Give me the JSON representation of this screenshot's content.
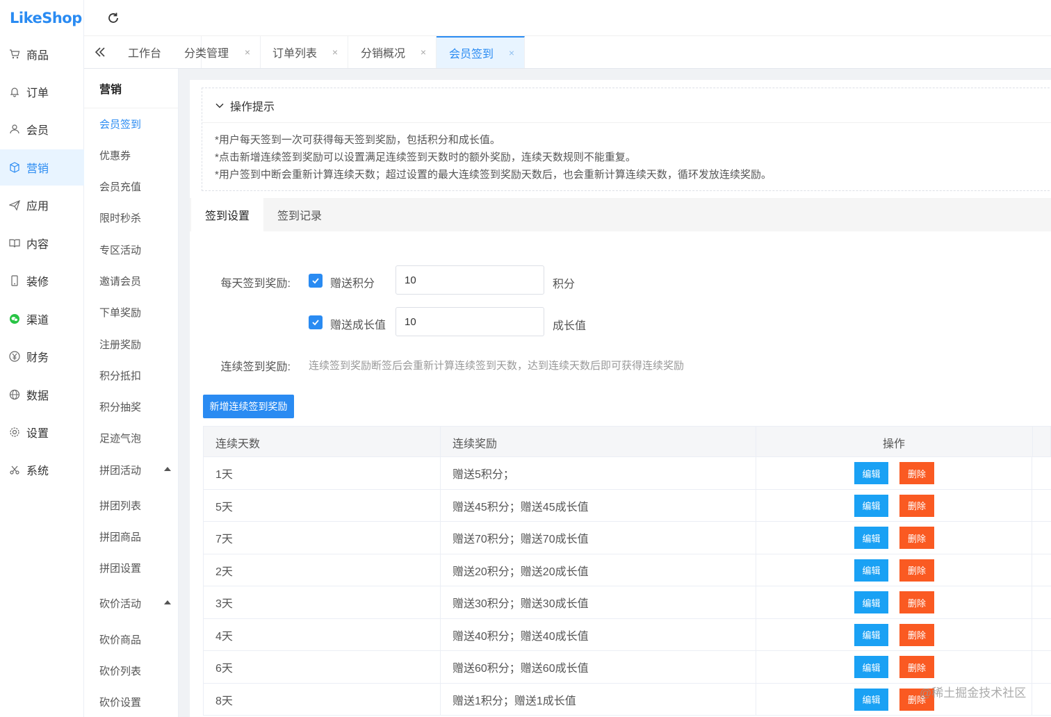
{
  "app": {
    "logo": "LikeShop",
    "refresh_icon": "refresh-icon",
    "accent": "#2a8bf2"
  },
  "sidebar": {
    "items": [
      {
        "label": "商品",
        "icon": "cart-icon"
      },
      {
        "label": "订单",
        "icon": "bell-icon"
      },
      {
        "label": "会员",
        "icon": "user-icon"
      },
      {
        "label": "营销",
        "icon": "box-icon"
      },
      {
        "label": "应用",
        "icon": "send-icon"
      },
      {
        "label": "内容",
        "icon": "book-icon"
      },
      {
        "label": "装修",
        "icon": "phone-icon"
      },
      {
        "label": "渠道",
        "icon": "wechat-icon"
      },
      {
        "label": "财务",
        "icon": "yen-icon"
      },
      {
        "label": "数据",
        "icon": "globe-icon"
      },
      {
        "label": "设置",
        "icon": "gear-icon"
      },
      {
        "label": "系统",
        "icon": "scissors-icon"
      }
    ],
    "active": "营销"
  },
  "tabs": [
    {
      "label": "工作台"
    },
    {
      "label": "分类管理",
      "close": "×"
    },
    {
      "label": "订单列表",
      "close": "×"
    },
    {
      "label": "分销概况",
      "close": "×"
    },
    {
      "label": "会员签到",
      "close": "×"
    }
  ],
  "submenu": {
    "title": "营销",
    "items": [
      "会员签到",
      "优惠券",
      "会员充值",
      "限时秒杀",
      "专区活动",
      "邀请会员",
      "下单奖励",
      "注册奖励",
      "积分抵扣",
      "积分抽奖",
      "足迹气泡",
      "拼团活动",
      "拼团列表",
      "拼团商品",
      "拼团设置",
      "砍价活动",
      "砍价商品",
      "砍价列表",
      "砍价设置"
    ]
  },
  "tips": {
    "title": "操作提示",
    "lines": [
      "*用户每天签到一次可获得每天签到奖励，包括积分和成长值。",
      "*点击新增连续签到奖励可以设置满足连续签到天数时的额外奖励，连续天数规则不能重复。",
      "*用户签到中断会重新计算连续天数；超过设置的最大连续签到奖励天数后，也会重新计算连续天数，循环发放连续奖励。"
    ]
  },
  "form_tabs": [
    "签到设置",
    "签到记录"
  ],
  "form": {
    "daily_label": "每天签到奖励:",
    "points_label": "赠送积分",
    "points_value": "10",
    "points_unit": "积分",
    "growth_label": "赠送成长值",
    "growth_value": "10",
    "growth_unit": "成长值",
    "continuous_label": "连续签到奖励:",
    "continuous_hint": "连续签到奖励断签后会重新计算连续签到天数，达到连续天数后即可获得连续奖励",
    "add_button": "新增连续签到奖励"
  },
  "table": {
    "headers": [
      "连续天数",
      "连续奖励",
      "操作"
    ],
    "edit_label": "编辑",
    "delete_label": "删除",
    "rows": [
      {
        "days": "1天",
        "reward": "赠送5积分；"
      },
      {
        "days": "5天",
        "reward": "赠送45积分；赠送45成长值"
      },
      {
        "days": "7天",
        "reward": "赠送70积分；赠送70成长值"
      },
      {
        "days": "2天",
        "reward": "赠送20积分；赠送20成长值"
      },
      {
        "days": "3天",
        "reward": "赠送30积分；赠送30成长值"
      },
      {
        "days": "4天",
        "reward": "赠送40积分；赠送40成长值"
      },
      {
        "days": "6天",
        "reward": "赠送60积分；赠送60成长值"
      },
      {
        "days": "8天",
        "reward": "赠送1积分；赠送1成长值"
      }
    ]
  },
  "watermark": "@稀土掘金技术社区"
}
